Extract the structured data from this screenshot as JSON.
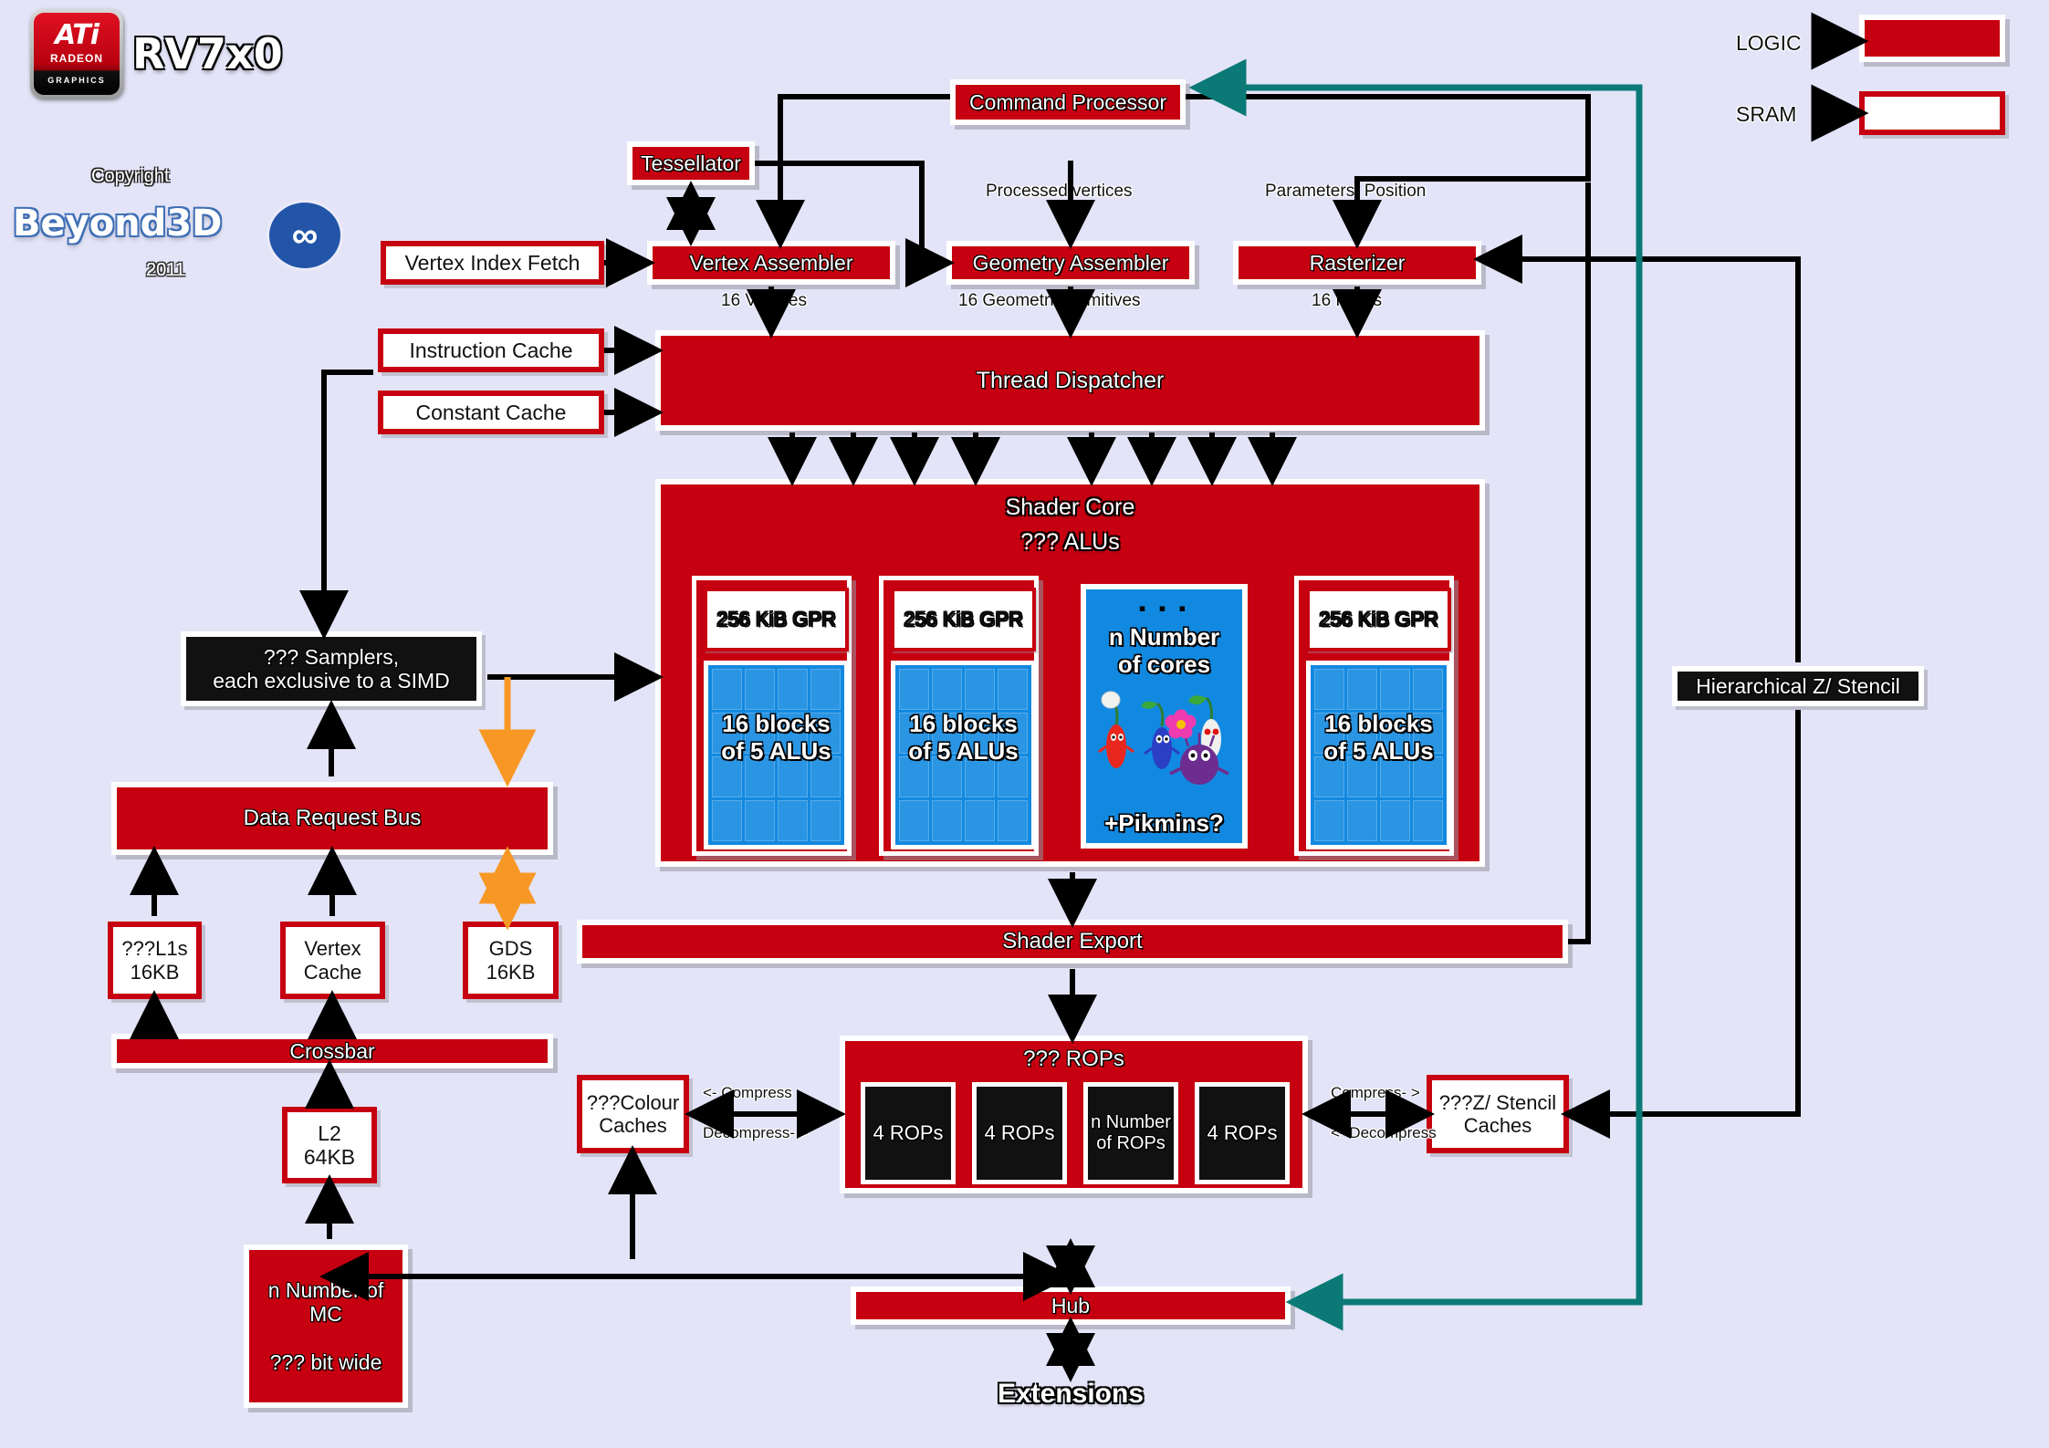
{
  "branding": {
    "logo_word": "ATi",
    "logo_radeon": "RADEON",
    "logo_graphics": "GRAPHICS",
    "chip": "RV7x0",
    "copyright": "Copyright",
    "site": "Beyond3D",
    "year": "2011",
    "infinity_glyph": "∞"
  },
  "legend": {
    "logic_label": "LOGIC",
    "sram_label": "SRAM",
    "logic_color": "#c60010",
    "sram_color": "#ffffff",
    "sram_border_color": "#c60010"
  },
  "blocks": {
    "command_processor": "Command  Processor",
    "tessellator": "Tessellator",
    "vertex_index_fetch": "Vertex  Index  Fetch",
    "vertex_assembler": "Vertex  Assembler",
    "geometry_assembler": "Geometry  Assembler",
    "rasterizer": "Rasterizer",
    "instruction_cache": "Instruction  Cache",
    "constant_cache": "Constant  Cache",
    "thread_dispatcher": "Thread  Dispatcher",
    "shader_core_title": "Shader  Core",
    "shader_core_alus": "??? ALUs",
    "samplers": "??? Samplers,\neach exclusive to a SIMD",
    "data_request_bus": "Data  Request  Bus",
    "l1s": "???L1s\n16KB",
    "vertex_cache": "Vertex\nCache",
    "gds": "GDS\n16KB",
    "crossbar": "Crossbar",
    "l2": "L2\n64KB",
    "memory_controllers": "n Number of\nMC\n\n??? bit wide",
    "shader_export": "Shader  Export",
    "rops_title": "??? ROPs",
    "colour_caches": "???Colour\nCaches",
    "z_stencil_caches": "???Z/ Stencil\nCaches",
    "hierarchical_z_stencil": "Hierarchical  Z/ Stencil",
    "hub": "Hub",
    "extensions": "Extensions"
  },
  "shader_core": {
    "simds": [
      {
        "gpr": "256 KiB GPR",
        "alus": "16 blocks\nof 5 ALUs",
        "type": "simd"
      },
      {
        "gpr": "256 KiB GPR",
        "alus": "16 blocks\nof 5 ALUs",
        "type": "simd"
      },
      {
        "ellipsis": "▪ ▪ ▪",
        "title": "n Number\nof cores",
        "footer": "+Pikmins?",
        "type": "ncores"
      },
      {
        "gpr": "256 KiB GPR",
        "alus": "16 blocks\nof 5 ALUs",
        "type": "simd"
      }
    ]
  },
  "rops": {
    "title": "??? ROPs",
    "units": [
      "4  ROPs",
      "4  ROPs",
      "n Number\nof ROPs",
      "4  ROPs"
    ]
  },
  "edge_labels": {
    "processed_vertices": "Processed  vertices",
    "parameters_position": "Parameters,  Position",
    "vertices_16": "16  Vertices",
    "geometric_primitives_16": "16  Geometric  primitives",
    "pixels_16": "16  Pixels",
    "compress_left": "<- Compress",
    "decompress_left": "Decompress- >",
    "compress_right": "Compress- >",
    "decompress_right": "<- Decompress"
  },
  "colors": {
    "background": "#e4e4f8",
    "logic_red": "#c60010",
    "alu_blue": "#1289e0",
    "teal_bus": "#0b7a77",
    "gds_orange": "#f79824",
    "black_block": "#111111"
  }
}
